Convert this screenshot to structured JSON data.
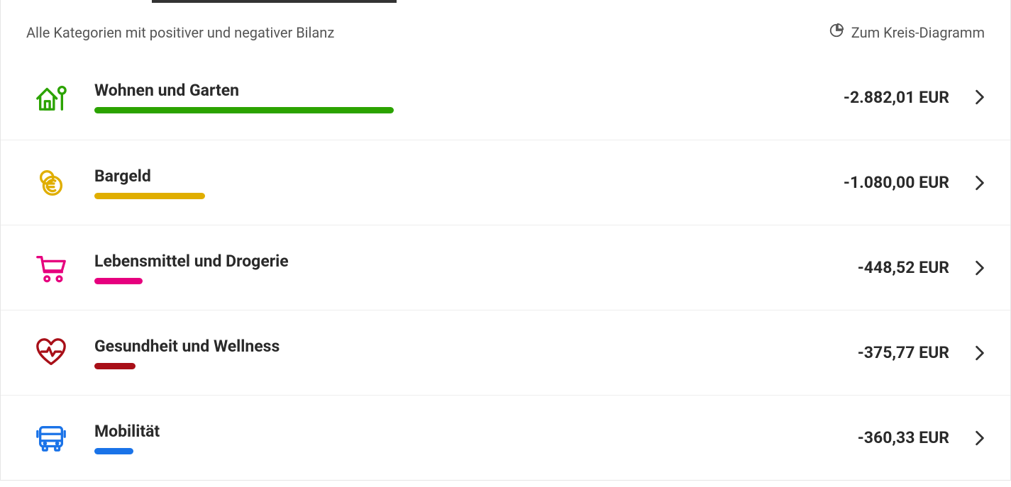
{
  "header": {
    "title": "Alle Kategorien mit positiver und negativer Bilanz",
    "chart_link": "Zum Kreis-Diagramm"
  },
  "categories": [
    {
      "icon": "house-garden-icon",
      "label": "Wohnen und Garten",
      "amount": "-2.882,01 EUR",
      "color": "#2ba300",
      "bar_pct": 42
    },
    {
      "icon": "cash-euro-icon",
      "label": "Bargeld",
      "amount": "-1.080,00 EUR",
      "color": "#e0ae00",
      "bar_pct": 15.5
    },
    {
      "icon": "shopping-cart-icon",
      "label": "Lebensmittel und Drogerie",
      "amount": "-448,52 EUR",
      "color": "#e6007e",
      "bar_pct": 6.8
    },
    {
      "icon": "heart-health-icon",
      "label": "Gesundheit und Wellness",
      "amount": "-375,77 EUR",
      "color": "#a80f18",
      "bar_pct": 5.8
    },
    {
      "icon": "bus-mobility-icon",
      "label": "Mobilität",
      "amount": "-360,33 EUR",
      "color": "#1a73e8",
      "bar_pct": 5.5
    }
  ],
  "chart_data": {
    "type": "bar",
    "title": "Alle Kategorien mit positiver und negativer Bilanz",
    "xlabel": "",
    "ylabel": "EUR",
    "categories": [
      "Wohnen und Garten",
      "Bargeld",
      "Lebensmittel und Drogerie",
      "Gesundheit und Wellness",
      "Mobilität"
    ],
    "values": [
      -2882.01,
      -1080.0,
      -448.52,
      -375.77,
      -360.33
    ],
    "colors": [
      "#2ba300",
      "#e0ae00",
      "#e6007e",
      "#a80f18",
      "#1a73e8"
    ]
  }
}
